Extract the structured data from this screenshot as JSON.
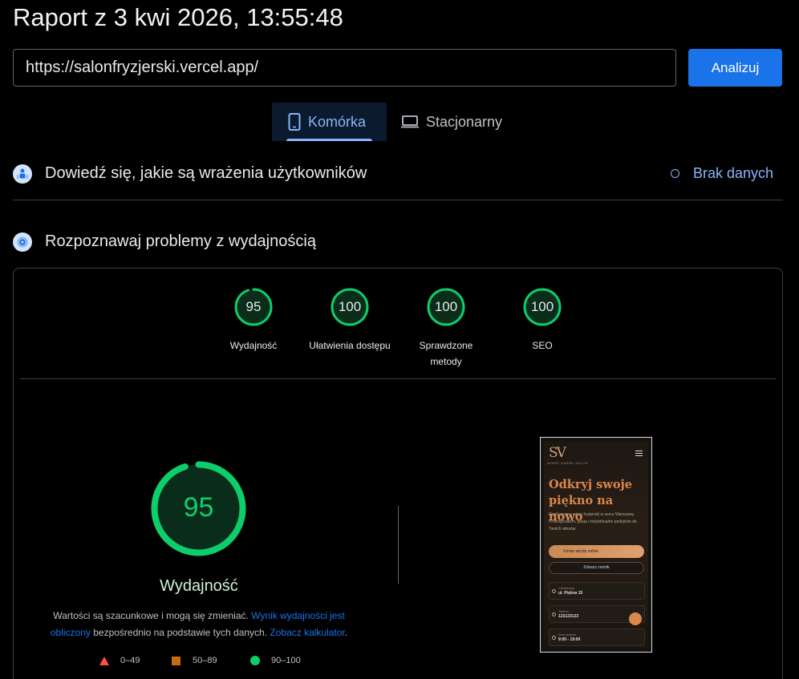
{
  "header": {
    "title": "Raport z 3 kwi 2026, 13:55:48"
  },
  "search": {
    "url": "https://salonfryzjerski.vercel.app/",
    "button": "Analizuj"
  },
  "tabs": [
    {
      "label": "Komórka",
      "icon": "phone-icon",
      "active": true
    },
    {
      "label": "Stacjonarny",
      "icon": "laptop-icon",
      "active": false
    }
  ],
  "crux": {
    "title": "Dowiedź się, jakie są wrażenia użytkowników",
    "status": "Brak danych",
    "icon": "users-icon"
  },
  "diagnose": {
    "title": "Rozpoznawaj problemy z wydajnością",
    "icon": "lighthouse-icon"
  },
  "scores": [
    {
      "value": "95",
      "label": "Wydajność",
      "fraction": 0.95
    },
    {
      "value": "100",
      "label": "Ułatwienia dostępu",
      "fraction": 1.0
    },
    {
      "value": "100",
      "label": "Sprawdzone metody",
      "fraction": 1.0
    },
    {
      "value": "100",
      "label": "SEO",
      "fraction": 1.0
    }
  ],
  "main_score": {
    "value": "95",
    "label": "Wydajność",
    "fraction": 0.95
  },
  "description": {
    "text1": "Wartości są szacunkowe i mogą się zmieniać.",
    "link1": "Wynik wydajności jest obliczony",
    "text2": "bezpośrednio na podstawie tych danych.",
    "link2": "Zobacz kalkulator",
    "text3": "."
  },
  "legend": [
    {
      "range": "0–49",
      "color": "#ff4e42"
    },
    {
      "range": "50–89",
      "color": "#c96a0d"
    },
    {
      "range": "90–100",
      "color": "#0cce6b"
    }
  ],
  "colors": {
    "pass": "#0cce6b",
    "accent": "#1a73e8",
    "tab_active": "#8ab4f8"
  },
  "phone_preview": {
    "logo": "SV",
    "tagline": "AVANT-GARDE SALON",
    "headline": "Odkryj swoje piękno na nowo",
    "paragraph": "Ekskluzywny salon fryzjerski w sercu Warszawy. Profesjonalizm, pasja i indywidualne podejście do Twoich włosów.",
    "cta_primary": "Umów wizytę online",
    "cta_secondary": "Zobacz cennik",
    "info": [
      {
        "key": "Lokalizacja",
        "value": "ul. Piękna 15"
      },
      {
        "key": "Telefon",
        "value": "123123123"
      },
      {
        "key": "Dziś otwarte",
        "value": "9:00 - 19:00"
      }
    ]
  }
}
